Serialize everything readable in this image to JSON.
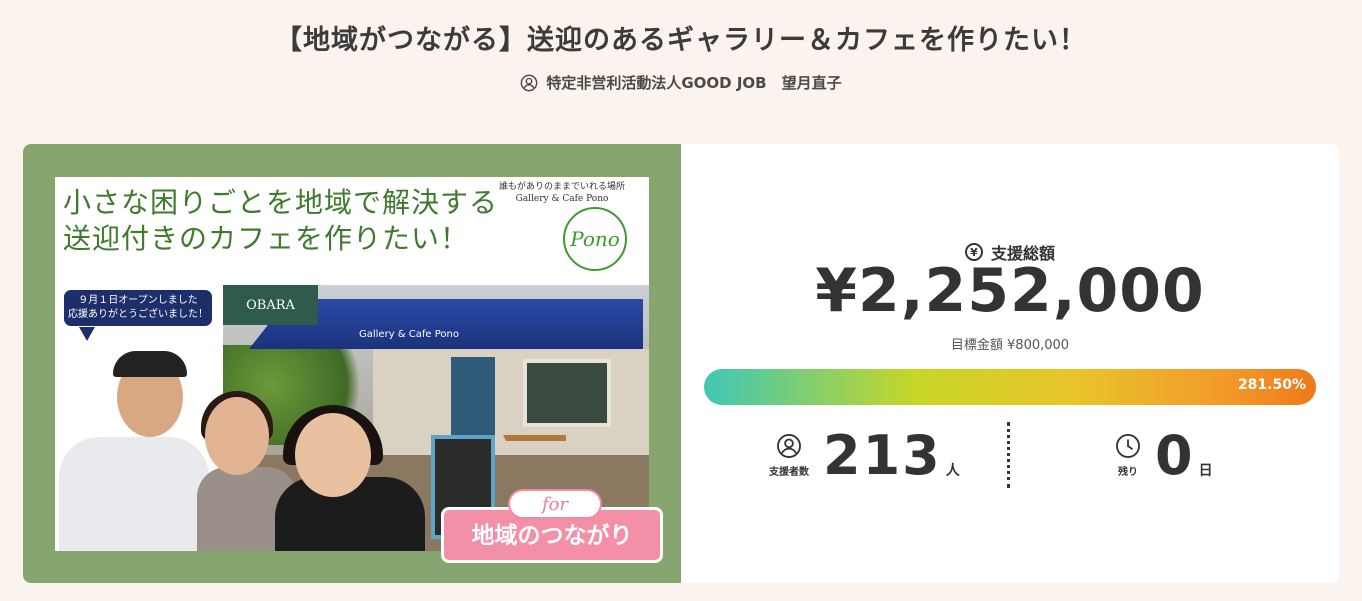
{
  "project": {
    "title": "【地域がつながる】送迎のあるギャラリー＆カフェを作りたい！",
    "owner": "特定非営利活動法人GOOD JOB　望月直子"
  },
  "hero": {
    "headline_line1": "小さな困りごとを地域で解決する",
    "headline_line2": "送迎付きのカフェを作りたい！",
    "brand_tagline": "誰もがありのままでいれる場所",
    "brand_name": "Gallery & Cafe Pono",
    "logo_text": "Pono",
    "shop_sign": "OBARA",
    "awning_text": "Gallery & Cafe Pono",
    "bubble_line1": "９月１日オープンしました",
    "bubble_line2": "応援ありがとうございました！",
    "for_label": "for",
    "for_main": "地域のつながり"
  },
  "stats": {
    "total_label": "支援総額",
    "total_value": "¥2,252,000",
    "goal_label": "目標金額 ¥800,000",
    "progress_text": "281.50%",
    "progress_fraction": 1.0,
    "supporters_label": "支援者数",
    "supporters_value": "213",
    "supporters_unit": "人",
    "remaining_label": "残り",
    "remaining_value": "0",
    "remaining_unit": "日"
  },
  "colors": {
    "page_bg": "#fbf3ee",
    "hero_bg": "#86a56f",
    "accent_pink": "#f48fa8",
    "headline_green": "#3f7a2e"
  },
  "icons": {
    "owner": "user-circle-icon",
    "total": "yen-circle-icon",
    "supporters": "user-circle-icon",
    "remaining": "clock-icon"
  }
}
